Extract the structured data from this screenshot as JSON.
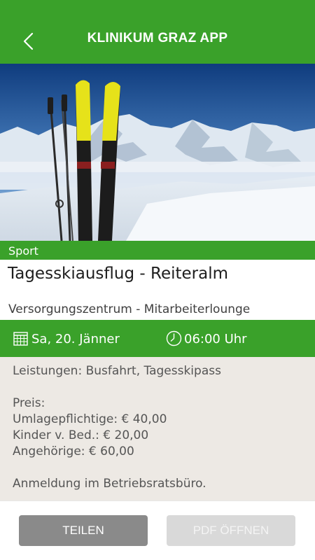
{
  "header": {
    "title": "KLINIKUM GRAZ APP",
    "back_icon": "chevron-left-icon"
  },
  "hero": {
    "alt": "Skis and poles in snow with mountains"
  },
  "event": {
    "category": "Sport",
    "title": "Tagesskiausflug - Reiteralm",
    "location": "Versorgungszentrum - Mitarbeiterlounge",
    "date": "Sa, 20. Jänner",
    "time": "06:00 Uhr",
    "date_icon": "calendar-icon",
    "time_icon": "clock-icon"
  },
  "details": {
    "services": "Leistungen: Busfahrt, Tagesskipass",
    "price_label": "Preis:",
    "price_lines": [
      "Umlagepflichtige: € 40,00",
      "Kinder v. Bed.: € 20,00",
      "Angehörige: € 60,00"
    ],
    "registration": "Anmeldung im Betriebsratsbüro."
  },
  "footer": {
    "share_label": "TEILEN",
    "pdf_label": "PDF ÖFFNEN"
  },
  "colors": {
    "accent": "#3aa12a",
    "details_bg": "#ede9e4",
    "share_button": "#8a8a8a",
    "pdf_button_disabled": "#d9d9d9"
  }
}
